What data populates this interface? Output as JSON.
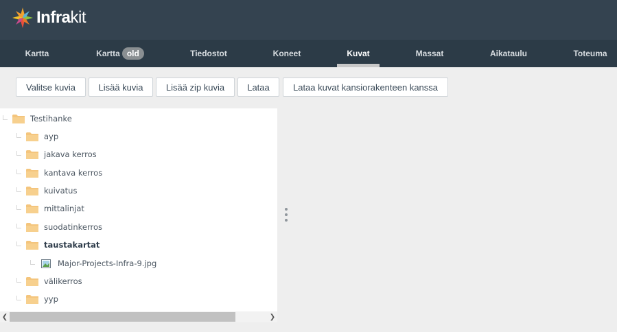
{
  "app": {
    "logo_bold": "Infra",
    "logo_light": "kit"
  },
  "nav": {
    "items": [
      {
        "label": "Kartta"
      },
      {
        "label": "Kartta",
        "badge": "old"
      },
      {
        "label": "Tiedostot"
      },
      {
        "label": "Koneet"
      },
      {
        "label": "Kuvat",
        "active": true
      },
      {
        "label": "Massat"
      },
      {
        "label": "Aikataulu"
      },
      {
        "label": "Toteuma"
      }
    ]
  },
  "toolbar": {
    "select_label": "Valitse kuvia",
    "add_label": "Lisää kuvia",
    "add_zip_label": "Lisää zip kuvia",
    "upload_label": "Lataa",
    "upload_folders_label": "Lataa kuvat kansiorakenteen kanssa"
  },
  "tree": {
    "root": "Testihanke",
    "folders": [
      "ayp",
      "jakava kerros",
      "kantava kerros",
      "kuivatus",
      "mittalinjat",
      "suodatinkerros",
      "taustakartat",
      "välikerros",
      "yyp"
    ],
    "selected_folder": "taustakartat",
    "file": "Major-Projects-Infra-9.jpg"
  },
  "colors": {
    "header_bg": "#344350",
    "nav_bg": "#2c3b47",
    "folder": "#f4c57d",
    "page_bg": "#eeeeee"
  },
  "icons": {
    "logo": "infrakit-star-logo",
    "folder": "folder-icon",
    "image_file": "image-file-icon",
    "scroll_left": "chevron-left-icon",
    "scroll_right": "chevron-right-icon",
    "splitter": "vertical-dots-icon"
  }
}
